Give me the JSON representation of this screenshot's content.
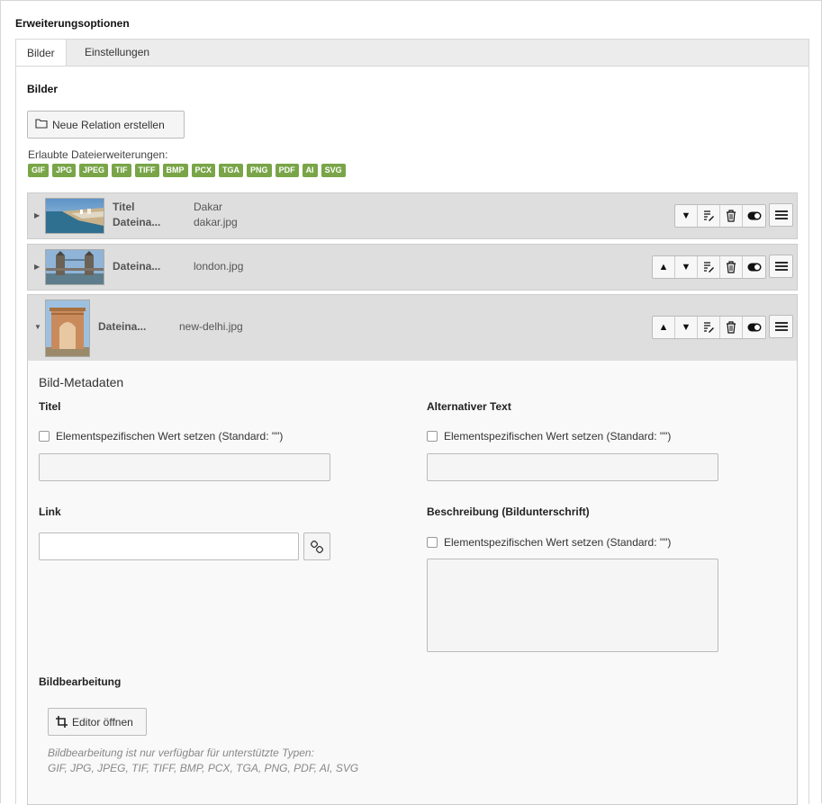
{
  "section_title": "Erweiterungsoptionen",
  "tabs": [
    {
      "label": "Bilder",
      "active": true
    },
    {
      "label": "Einstellungen",
      "active": false
    }
  ],
  "images_heading": "Bilder",
  "new_relation_label": "Neue Relation erstellen",
  "allowed_label": "Erlaubte Dateierweiterungen:",
  "allowed_extensions": [
    "GIF",
    "JPG",
    "JPEG",
    "TIF",
    "TIFF",
    "BMP",
    "PCX",
    "TGA",
    "PNG",
    "PDF",
    "AI",
    "SVG"
  ],
  "relations": [
    {
      "expanded": false,
      "fields": [
        {
          "key": "Titel",
          "value": "Dakar"
        },
        {
          "key": "Dateina...",
          "value": "dakar.jpg"
        }
      ],
      "icons": [
        "arrow-down-icon",
        "edit-icon",
        "trash-icon",
        "toggle-icon"
      ]
    },
    {
      "expanded": false,
      "fields": [
        {
          "key": "Dateina...",
          "value": "london.jpg"
        }
      ],
      "icons": [
        "arrow-up-icon",
        "arrow-down-icon",
        "edit-icon",
        "trash-icon",
        "toggle-icon"
      ]
    },
    {
      "expanded": true,
      "fields": [
        {
          "key": "Dateina...",
          "value": "new-delhi.jpg"
        }
      ],
      "icons": [
        "arrow-up-icon",
        "arrow-down-icon",
        "edit-icon",
        "trash-icon",
        "toggle-icon"
      ]
    }
  ],
  "metadata": {
    "title": "Bild-Metadaten",
    "titel_label": "Titel",
    "titel_checkbox": "Elementspezifischen Wert setzen (Standard: \"\")",
    "alt_label": "Alternativer Text",
    "alt_checkbox": "Elementspezifischen Wert setzen (Standard: \"\")",
    "link_label": "Link",
    "link_value": "",
    "desc_label": "Beschreibung (Bildunterschrift)",
    "desc_checkbox": "Elementspezifischen Wert setzen (Standard: \"\")",
    "edit_label": "Bildbearbeitung",
    "editor_button": "Editor öffnen",
    "help_line1": "Bildbearbeitung ist nur verfügbar für unterstützte Typen:",
    "help_line2": "GIF, JPG, JPEG, TIF, TIFF, BMP, PCX, TGA, PNG, PDF, AI, SVG"
  },
  "colors": {
    "badge": "#79a548",
    "relation_header": "#dedede"
  }
}
